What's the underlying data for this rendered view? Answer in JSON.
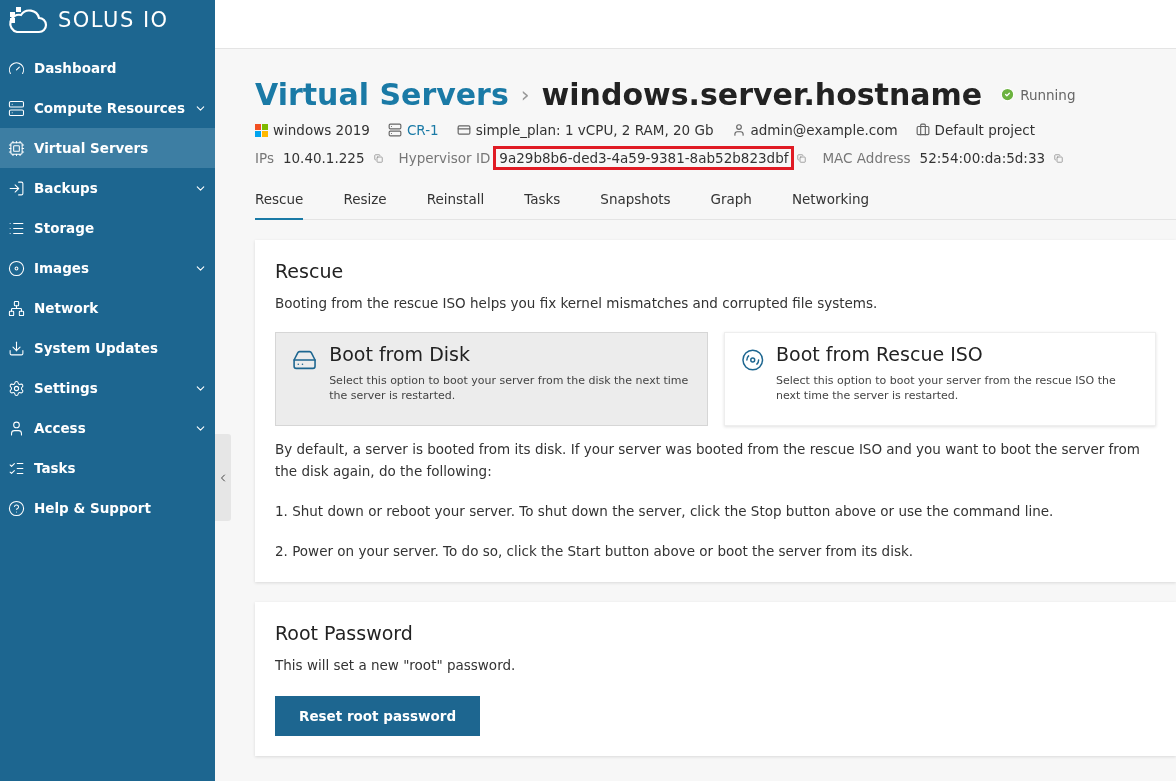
{
  "brand": {
    "name": "SOLUS IO"
  },
  "sidebar": {
    "items": [
      {
        "label": "Dashboard",
        "selected": false,
        "expandable": false
      },
      {
        "label": "Compute Resources",
        "selected": false,
        "expandable": true
      },
      {
        "label": "Virtual Servers",
        "selected": true,
        "expandable": false
      },
      {
        "label": "Backups",
        "selected": false,
        "expandable": true
      },
      {
        "label": "Storage",
        "selected": false,
        "expandable": false
      },
      {
        "label": "Images",
        "selected": false,
        "expandable": true
      },
      {
        "label": "Network",
        "selected": false,
        "expandable": false
      },
      {
        "label": "System Updates",
        "selected": false,
        "expandable": false
      },
      {
        "label": "Settings",
        "selected": false,
        "expandable": true
      },
      {
        "label": "Access",
        "selected": false,
        "expandable": true
      },
      {
        "label": "Tasks",
        "selected": false,
        "expandable": false
      },
      {
        "label": "Help & Support",
        "selected": false,
        "expandable": false
      }
    ]
  },
  "breadcrumb": {
    "parent": "Virtual Servers",
    "separator": "›",
    "current": "windows.server.hostname"
  },
  "status": "Running",
  "meta": [
    {
      "text": "windows 2019",
      "link": false
    },
    {
      "text": "CR-1",
      "link": true
    },
    {
      "text": "simple_plan: 1 vCPU, 2 RAM, 20 Gb",
      "link": false
    },
    {
      "text": "admin@example.com",
      "link": false
    },
    {
      "text": "Default project",
      "link": false
    }
  ],
  "ids": [
    {
      "label": "IPs",
      "value": "10.40.1.225",
      "highlighted": false
    },
    {
      "label": "Hypervisor ID",
      "value": "9a29b8b6-ded3-4a59-9381-8ab52b823dbf",
      "highlighted": true
    },
    {
      "label": "MAC Address",
      "value": "52:54:00:da:5d:33",
      "highlighted": false
    }
  ],
  "tabs": [
    {
      "label": "Rescue",
      "selected": true
    },
    {
      "label": "Resize",
      "selected": false
    },
    {
      "label": "Reinstall",
      "selected": false
    },
    {
      "label": "Tasks",
      "selected": false
    },
    {
      "label": "Snapshots",
      "selected": false
    },
    {
      "label": "Graph",
      "selected": false
    },
    {
      "label": "Networking",
      "selected": false
    }
  ],
  "rescue": {
    "title": "Rescue",
    "intro": "Booting from the rescue ISO helps you fix kernel mismatches and corrupted file systems.",
    "options": [
      {
        "kind": "disk",
        "title": "Boot from Disk",
        "description": "Select this option to boot your server from the disk the next time the server is restarted.",
        "selected": true
      },
      {
        "kind": "iso",
        "title": "Boot from Rescue ISO",
        "description": "Select this option to boot your server from the rescue ISO the next time the server is restarted.",
        "selected": false
      }
    ],
    "paragraphs": [
      "By default, a server is booted from its disk. If your server was booted from the rescue ISO and you want to boot the server from the disk again, do the following:",
      "1. Shut down or reboot your server. To shut down the server, click the Stop button above or use the command line.",
      "2. Power on your server. To do so, click the Start button above or boot the server from its disk."
    ]
  },
  "root_password": {
    "title": "Root Password",
    "text": "This will set a new \"root\" password.",
    "button": "Reset root password"
  }
}
